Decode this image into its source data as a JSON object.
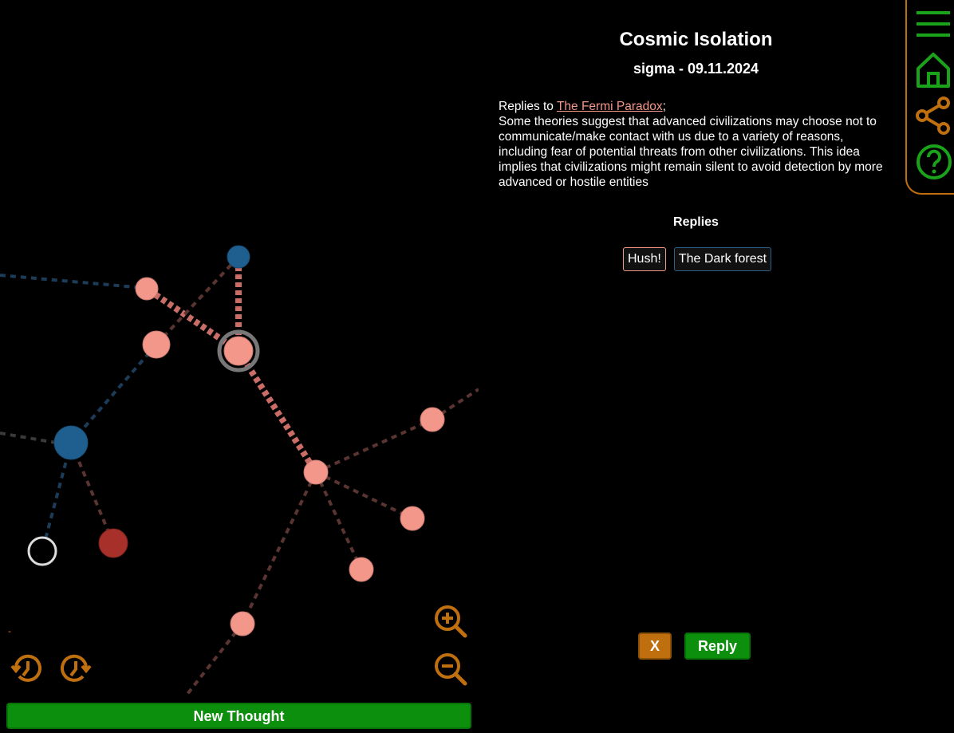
{
  "graph": {
    "nodes": [
      {
        "id": "current",
        "kind": "reply",
        "selected": true
      },
      {
        "id": "n-top-blue",
        "kind": "root"
      },
      {
        "id": "n-left-pink",
        "kind": "reply"
      },
      {
        "id": "n-mid-pink",
        "kind": "reply"
      },
      {
        "id": "n-blue-big",
        "kind": "root"
      },
      {
        "id": "n-hub",
        "kind": "reply"
      },
      {
        "id": "n-right-1",
        "kind": "reply"
      },
      {
        "id": "n-right-2",
        "kind": "reply"
      },
      {
        "id": "n-bottom-1",
        "kind": "reply"
      },
      {
        "id": "n-bottom-2",
        "kind": "reply"
      },
      {
        "id": "n-white",
        "kind": "empty"
      },
      {
        "id": "n-red",
        "kind": "flagged"
      }
    ],
    "colors": {
      "reply": "#f3978a",
      "root": "#1f5f8f",
      "flagged": "#a8302a",
      "selected_ring": "#777777",
      "edge_strong": "#c96d66",
      "edge_weak": "#5a3431",
      "edge_blue": "#1c3c58",
      "edge_grey": "#3a3a3a"
    }
  },
  "controls": {
    "history_back_icon": "history-back-icon",
    "history_forward_icon": "history-forward-icon",
    "zoom_in_icon": "zoom-in-icon",
    "zoom_out_icon": "zoom-out-icon",
    "small_marker": "-",
    "new_thought_label": "New Thought"
  },
  "thought": {
    "title": "Cosmic Isolation",
    "subtitle": "sigma - 09.11.2024",
    "replies_to_prefix": "Replies to ",
    "replies_to_link": "The Fermi Paradox",
    "replies_to_suffix": ";",
    "body": "Some theories suggest that advanced civilizations may choose not to communicate/make contact with us due to a variety of reasons, including fear of potential threats from other civilizations. This idea implies that civilizations might remain silent to avoid detection by more advanced or hostile entities",
    "replies_heading": "Replies",
    "replies": [
      {
        "label": "Hush!",
        "style": "pink"
      },
      {
        "label": "The Dark forest",
        "style": "blue"
      }
    ],
    "close_label": "X",
    "reply_label": "Reply"
  },
  "nav": {
    "icons": [
      "menu-icon",
      "home-icon",
      "share-icon",
      "help-icon"
    ],
    "accent": "#1aa31a",
    "border": "#c06f0f"
  },
  "theme": {
    "orange": "#c06f0f",
    "green": "#0c8f0c"
  }
}
